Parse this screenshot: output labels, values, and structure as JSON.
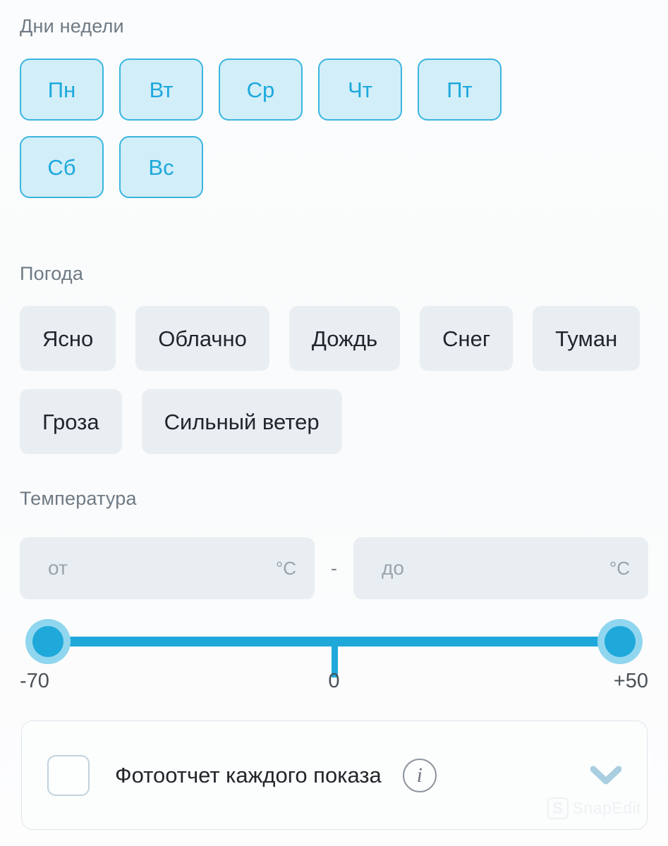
{
  "days": {
    "label": "Дни недели",
    "items": [
      {
        "label": "Пн"
      },
      {
        "label": "Вт"
      },
      {
        "label": "Ср"
      },
      {
        "label": "Чт"
      },
      {
        "label": "Пт"
      },
      {
        "label": "Сб"
      },
      {
        "label": "Вс"
      }
    ],
    "selected_fill": "#d2eef8",
    "selected_border": "#3ab5e0",
    "selected_text": "#1ca8dd"
  },
  "weather": {
    "label": "Погода",
    "items": [
      {
        "label": "Ясно"
      },
      {
        "label": "Облачно"
      },
      {
        "label": "Дождь"
      },
      {
        "label": "Снег"
      },
      {
        "label": "Туман"
      },
      {
        "label": "Гроза"
      },
      {
        "label": "Сильный ветер"
      }
    ],
    "chip_fill": "#e9eef2",
    "chip_text": "#20252b"
  },
  "temperature": {
    "label": "Температура",
    "from": {
      "value": "",
      "placeholder": "от",
      "unit": "°C"
    },
    "separator": "-",
    "to": {
      "value": "",
      "placeholder": "до",
      "unit": "°C"
    },
    "slider": {
      "min_label": "-70",
      "mid_label": "0",
      "max_label": "+50",
      "min_value": -70,
      "max_value": 50,
      "current_min": -70,
      "current_max": 50,
      "track_color": "#1fa8da",
      "handle_halo_color": "#8fd6ee"
    }
  },
  "photo_report": {
    "checkbox_checked": false,
    "label": "Фотоотчет каждого показа",
    "info_icon_glyph": "i",
    "chevron_color": "#a8cee0"
  },
  "watermark": {
    "badge": "S",
    "text": "SnapEdit"
  }
}
